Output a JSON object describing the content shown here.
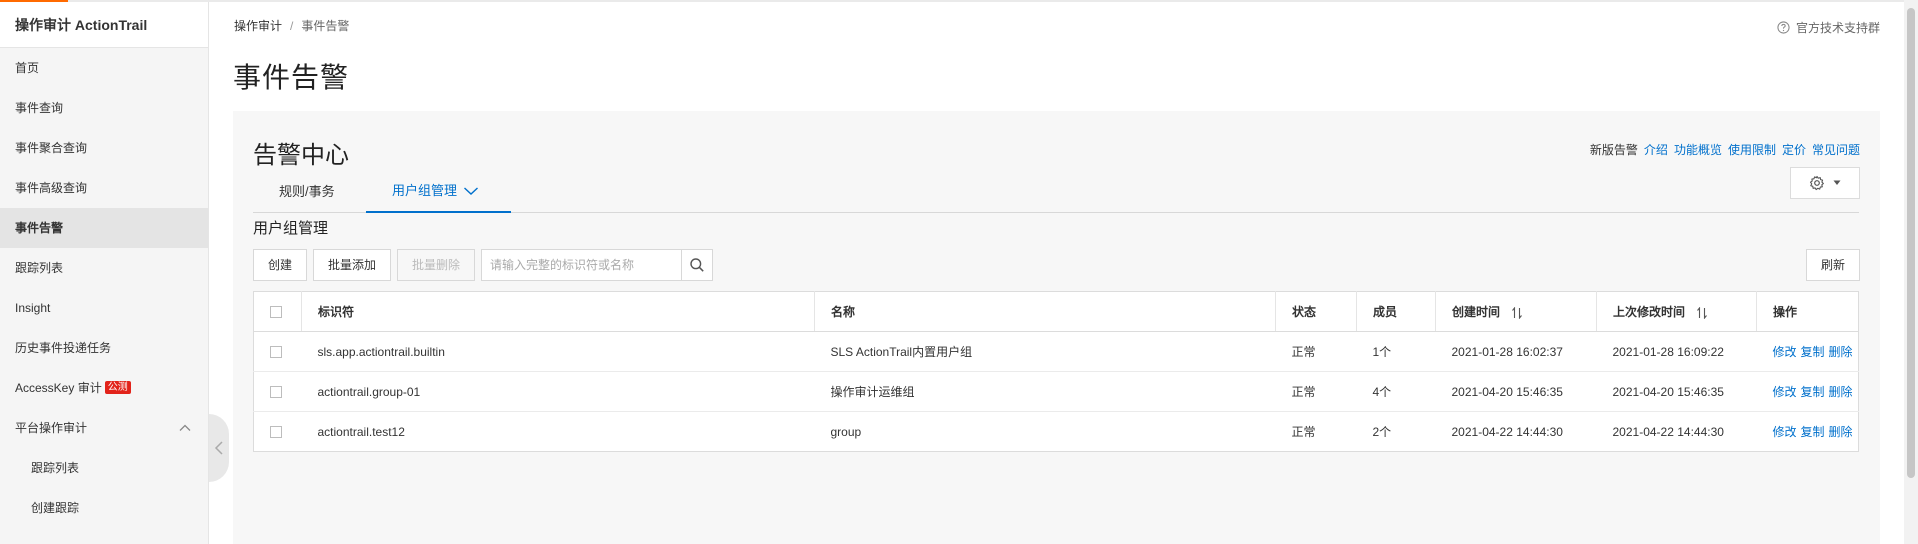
{
  "sidebar": {
    "title": "操作审计 ActionTrail",
    "items": [
      {
        "label": "首页"
      },
      {
        "label": "事件查询"
      },
      {
        "label": "事件聚合查询"
      },
      {
        "label": "事件高级查询"
      },
      {
        "label": "事件告警"
      },
      {
        "label": "跟踪列表"
      },
      {
        "label": "Insight"
      },
      {
        "label": "历史事件投递任务"
      },
      {
        "label": "AccessKey 审计",
        "badge": "公测"
      },
      {
        "label": "平台操作审计"
      },
      {
        "label": "跟踪列表"
      },
      {
        "label": "创建跟踪"
      }
    ],
    "active_item": "事件告警"
  },
  "breadcrumb": {
    "parent": "操作审计",
    "sep": "/",
    "current": "事件告警"
  },
  "help": {
    "label": "官方技术支持群"
  },
  "page": {
    "title": "事件告警"
  },
  "card": {
    "title": "告警中心",
    "links": {
      "new_label": "新版告警",
      "intro": "介绍",
      "overview": "功能概览",
      "limits": "使用限制",
      "pricing": "定价",
      "faq": "常见问题"
    }
  },
  "tabs": [
    {
      "label": "规则/事务"
    },
    {
      "label": "用户组管理"
    }
  ],
  "section": {
    "title": "用户组管理"
  },
  "toolbar": {
    "create": "创建",
    "batch_add": "批量添加",
    "batch_delete": "批量删除",
    "search_placeholder": "请输入完整的标识符或名称",
    "refresh": "刷新"
  },
  "table": {
    "headers": {
      "id": "标识符",
      "name": "名称",
      "status": "状态",
      "members": "成员",
      "created": "创建时间",
      "modified": "上次修改时间",
      "actions": "操作"
    },
    "action_labels": {
      "edit": "修改",
      "copy": "复制",
      "delete": "删除"
    },
    "rows": [
      {
        "id": "sls.app.actiontrail.builtin",
        "name": "SLS ActionTrail内置用户组",
        "status": "正常",
        "members": "1个",
        "created": "2021-01-28 16:02:37",
        "modified": "2021-01-28 16:09:22"
      },
      {
        "id": "actiontrail.group-01",
        "name": "操作审计运维组",
        "status": "正常",
        "members": "4个",
        "created": "2021-04-20 15:46:35",
        "modified": "2021-04-20 15:46:35"
      },
      {
        "id": "actiontrail.test12",
        "name": "group",
        "status": "正常",
        "members": "2个",
        "created": "2021-04-22 14:44:30",
        "modified": "2021-04-22 14:44:30"
      }
    ]
  },
  "colors": {
    "accent": "#0070cc",
    "brand": "#ff6a00",
    "badge": "#e2231a"
  }
}
